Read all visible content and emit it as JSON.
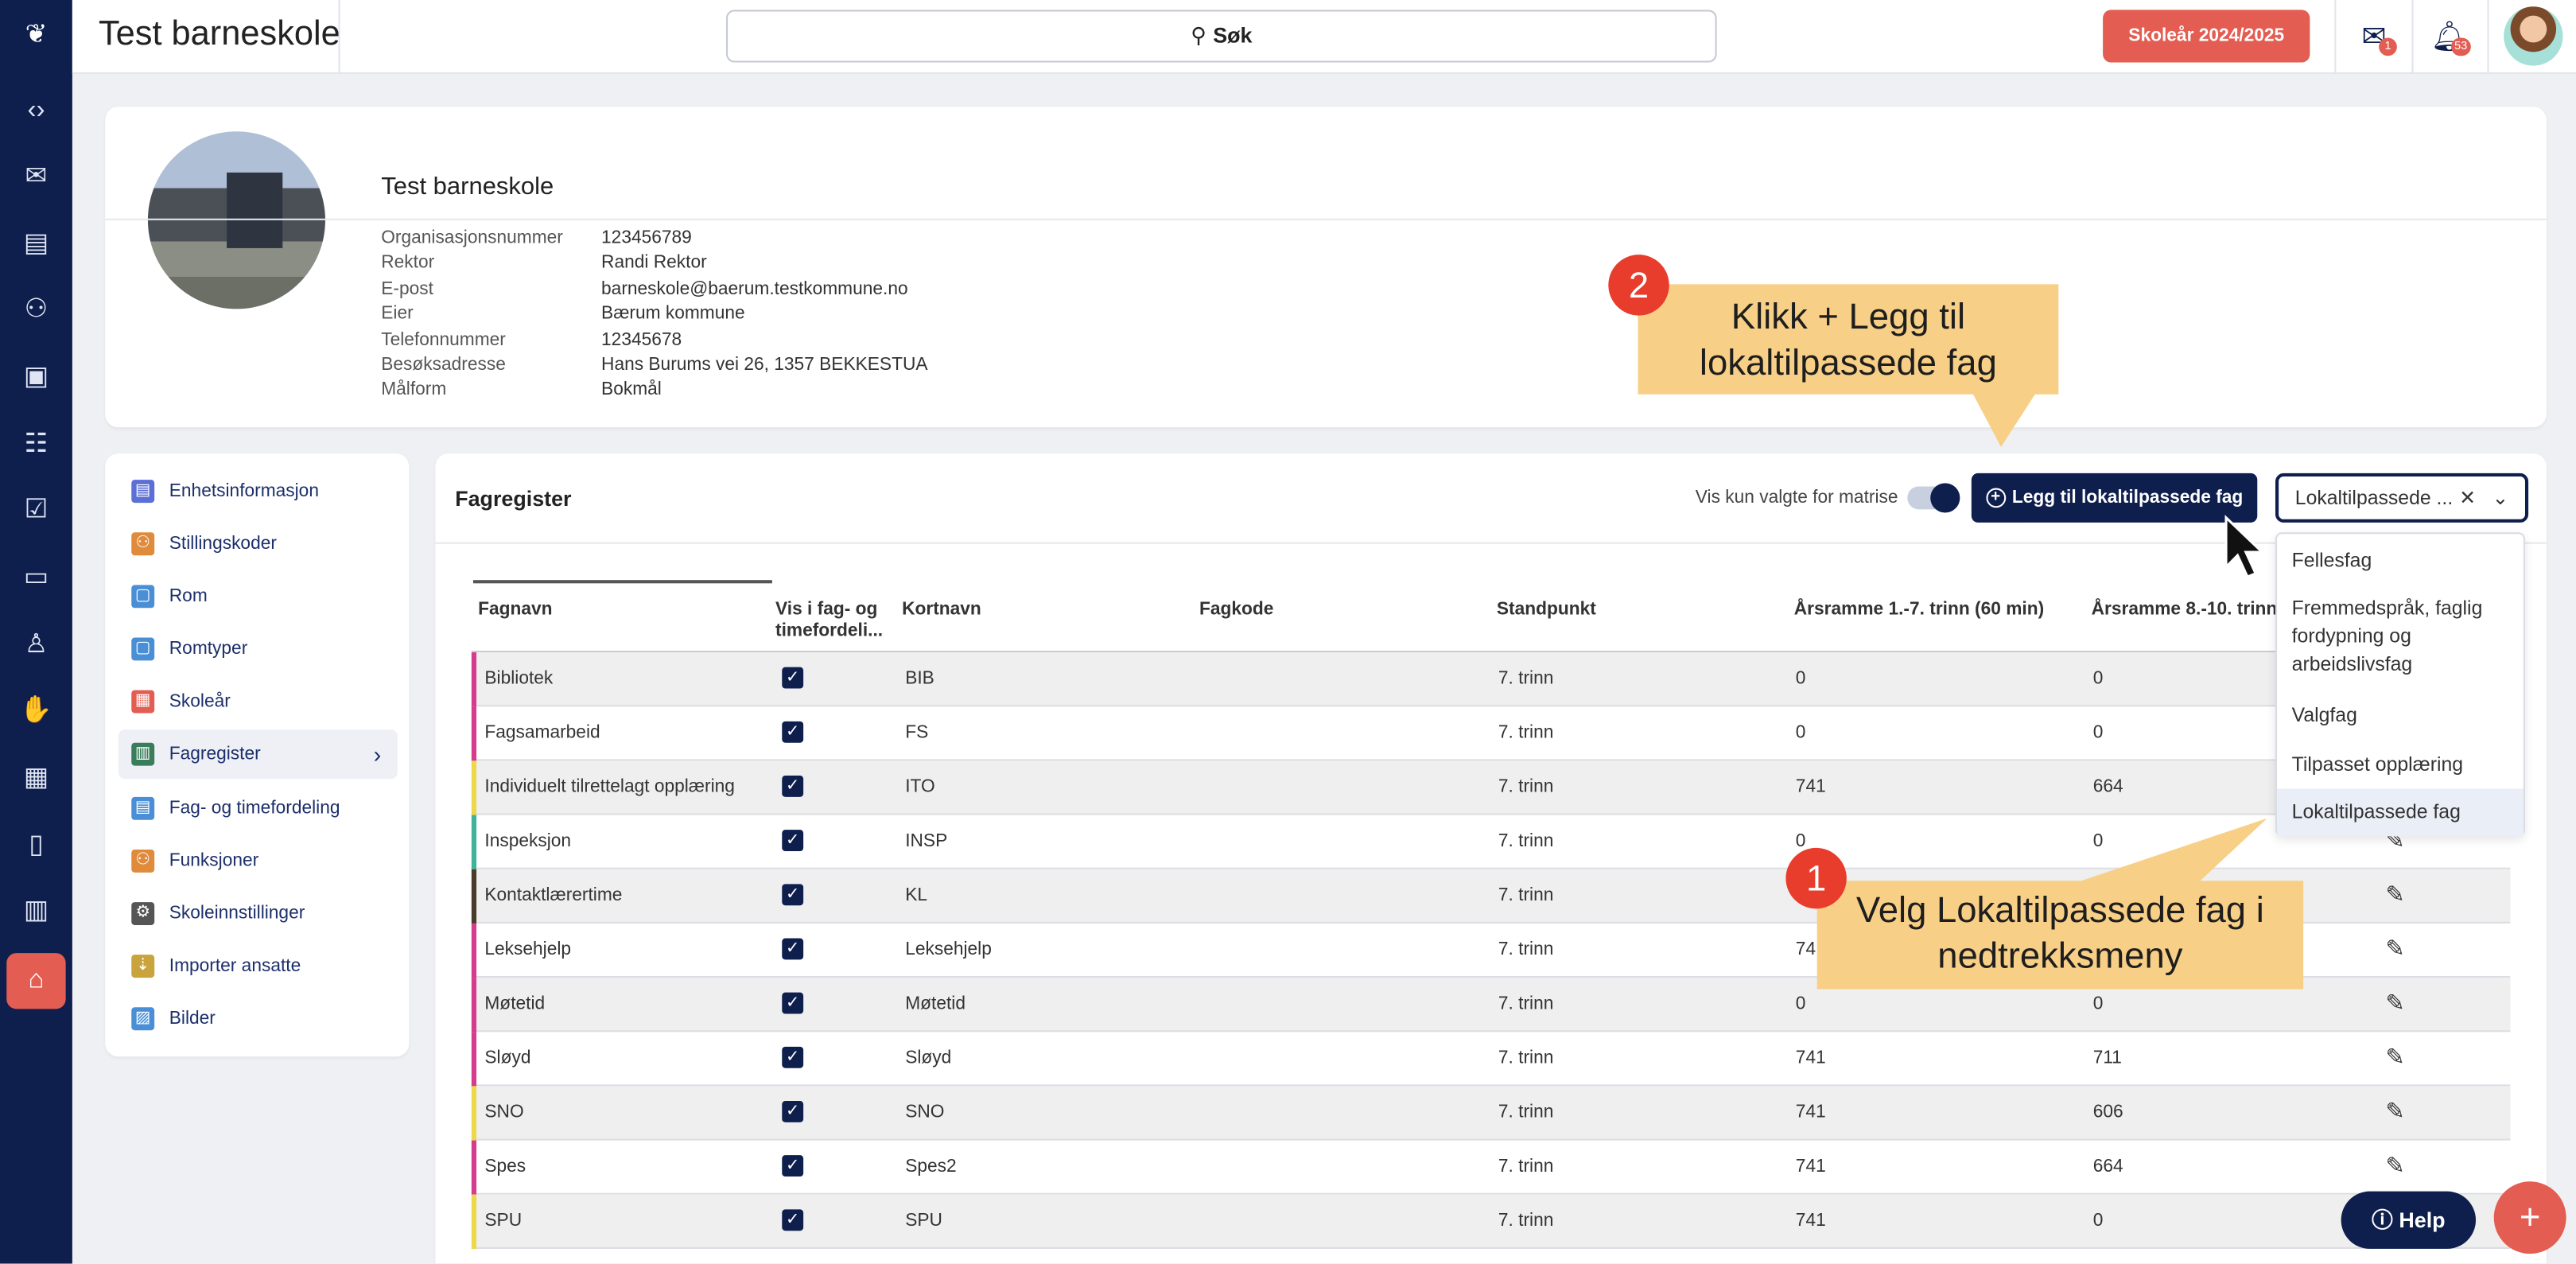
{
  "colors": {
    "navy": "#0f1f4d",
    "red": "#e35d52",
    "callout": "#f8cf86",
    "badge_red": "#e83c2c"
  },
  "app": {
    "title": "Test barneskole"
  },
  "search": {
    "label": "Søk",
    "icon": "search-icon"
  },
  "topbar": {
    "year_button": "Skoleår 2024/2025",
    "mail_count": "1",
    "notif_count": "53"
  },
  "rail": {
    "icons": [
      "logo-icon",
      "code-icon",
      "mail-icon",
      "news-icon",
      "people-icon",
      "clipboard-icon",
      "team-icon",
      "checklist-icon",
      "id-card-icon",
      "person-icon",
      "hand-icon",
      "gift-icon",
      "document-icon",
      "chart-icon",
      "school-icon"
    ]
  },
  "school": {
    "name": "Test barneskole",
    "info": [
      {
        "k": "Organisasjonsnummer",
        "v": "123456789"
      },
      {
        "k": "Rektor",
        "v": "Randi Rektor"
      },
      {
        "k": "E-post",
        "v": "barneskole@baerum.testkommune.no"
      },
      {
        "k": "Eier",
        "v": "Bærum kommune"
      },
      {
        "k": "Telefonnummer",
        "v": "12345678"
      },
      {
        "k": "Besøksadresse",
        "v": "Hans Burums vei 26, 1357 BEKKESTUA"
      },
      {
        "k": "Målform",
        "v": "Bokmål"
      }
    ]
  },
  "menu": [
    {
      "label": "Enhetsinformasjon",
      "icon": "id-card-icon",
      "color": "#5b6fd6"
    },
    {
      "label": "Stillingskoder",
      "icon": "people-icon",
      "color": "#e08a3c"
    },
    {
      "label": "Rom",
      "icon": "room-icon",
      "color": "#4a8fd6"
    },
    {
      "label": "Romtyper",
      "icon": "room-types-icon",
      "color": "#4a8fd6"
    },
    {
      "label": "Skoleår",
      "icon": "calendar-icon",
      "color": "#e35d52"
    },
    {
      "label": "Fagregister",
      "icon": "books-icon",
      "color": "#3a7d5a"
    },
    {
      "label": "Fag- og timefordeling",
      "icon": "schedule-icon",
      "color": "#4a8fd6"
    },
    {
      "label": "Funksjoner",
      "icon": "functions-icon",
      "color": "#e08a3c"
    },
    {
      "label": "Skoleinnstillinger",
      "icon": "gear-icon",
      "color": "#555"
    },
    {
      "label": "Importer ansatte",
      "icon": "import-icon",
      "color": "#c9a33c"
    },
    {
      "label": "Bilder",
      "icon": "image-icon",
      "color": "#4a8fd6"
    }
  ],
  "fagregister": {
    "title": "Fagregister",
    "toggle_label": "Vis kun valgte for matrise",
    "add_button": "Legg til lokaltilpassede fag",
    "select_value": "Lokaltilpassede ...",
    "columns": [
      "Fagnavn",
      "Vis i fag- og timefordeli...",
      "Kortnavn",
      "Fagkode",
      "Standpunkt",
      "Årsramme 1.-7. trinn (60 min)",
      "Årsramme 8.-10. trinn"
    ],
    "rows": [
      {
        "name": "Bibliotek",
        "short": "BIB",
        "code": "",
        "level": "7. trinn",
        "y17": "0",
        "y810": "0",
        "color": "#d63c8c"
      },
      {
        "name": "Fagsamarbeid",
        "short": "FS",
        "code": "",
        "level": "7. trinn",
        "y17": "0",
        "y810": "0",
        "color": "#d63c8c"
      },
      {
        "name": "Individuelt tilrettelagt opplæring",
        "short": "ITO",
        "code": "",
        "level": "7. trinn",
        "y17": "741",
        "y810": "664",
        "color": "#ecd84a"
      },
      {
        "name": "Inspeksjon",
        "short": "INSP",
        "code": "",
        "level": "7. trinn",
        "y17": "0",
        "y810": "0",
        "color": "#3fb39a"
      },
      {
        "name": "Kontaktlærertime",
        "short": "KL",
        "code": "",
        "level": "7. trinn",
        "y17": "",
        "y810": "",
        "color": "#4a3a2a"
      },
      {
        "name": "Leksehjelp",
        "short": "Leksehjelp",
        "code": "",
        "level": "7. trinn",
        "y17": "741",
        "y810": "",
        "color": "#d63c8c"
      },
      {
        "name": "Møtetid",
        "short": "Møtetid",
        "code": "",
        "level": "7. trinn",
        "y17": "0",
        "y810": "0",
        "color": "#d63c8c"
      },
      {
        "name": "Sløyd",
        "short": "Sløyd",
        "code": "",
        "level": "7. trinn",
        "y17": "741",
        "y810": "711",
        "color": "#d63c8c"
      },
      {
        "name": "SNO",
        "short": "SNO",
        "code": "",
        "level": "7. trinn",
        "y17": "741",
        "y810": "606",
        "color": "#ecd84a"
      },
      {
        "name": "Spes",
        "short": "Spes2",
        "code": "",
        "level": "7. trinn",
        "y17": "741",
        "y810": "664",
        "color": "#d63c8c"
      },
      {
        "name": "SPU",
        "short": "SPU",
        "code": "",
        "level": "7. trinn",
        "y17": "741",
        "y810": "0",
        "color": "#ecd84a"
      }
    ]
  },
  "dropdown": {
    "options": [
      "Fellesfag",
      "Fremmedspråk, faglig fordypning og arbeidslivsfag",
      "Valgfag",
      "Tilpasset opplæring",
      "Lokaltilpassede fag"
    ],
    "selected": "Lokaltilpassede fag"
  },
  "callouts": {
    "step1_number": "1",
    "step1_text": "Velg Lokaltilpassede fag i nedtrekksmeny",
    "step2_number": "2",
    "step2_text": "Klikk + Legg til lokaltilpassede fag"
  },
  "help": {
    "label": "Help"
  },
  "fab": {
    "label": "+"
  }
}
